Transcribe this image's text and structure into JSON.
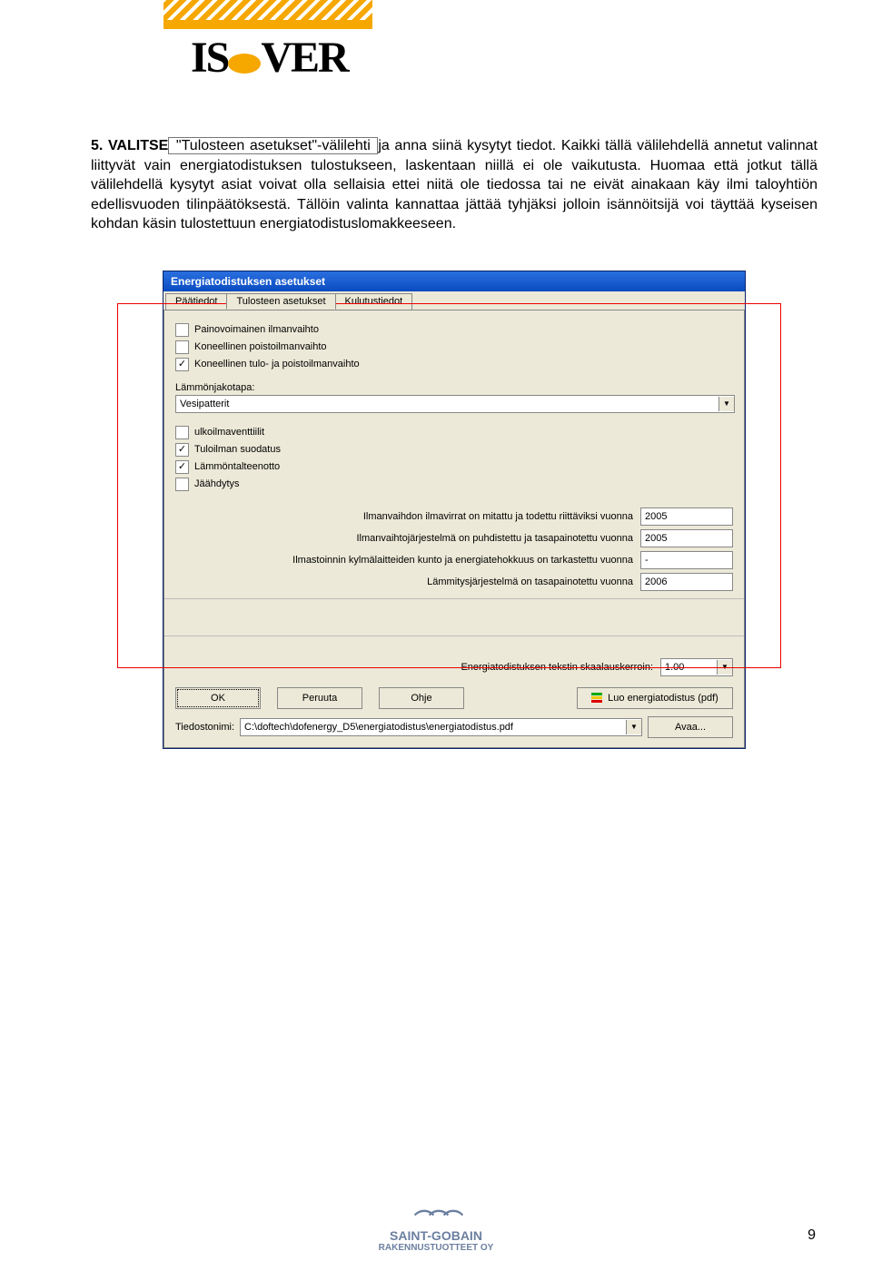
{
  "header": {
    "logo_text": "ISOVER"
  },
  "body": {
    "lead": "5. VALITSE",
    "text_after_lead": " \"Tulosteen asetukset\"-välilehti ",
    "text_rest": "ja anna siinä kysytyt tiedot. Kaikki tällä välilehdellä annetut valinnat liittyvät vain energiatodistuksen tulostukseen, laskentaan niillä ei ole vaikutusta. Huomaa että jotkut tällä välilehdellä kysytyt asiat voivat olla sellaisia ettei niitä ole tiedossa tai ne eivät ainakaan käy ilmi taloyhtiön edellisvuoden tilinpäätöksestä. Tällöin valinta kannattaa jättää tyhjäksi jolloin isännöitsijä voi täyttää kyseisen kohdan käsin tulostettuun energiatodistuslomakkeeseen."
  },
  "dialog": {
    "title": "Energiatodistuksen asetukset",
    "tabs": {
      "t0": "Päätiedot",
      "t1": "Tulosteen asetukset",
      "t2": "Kulutustiedot"
    },
    "checks": {
      "c1": "Painovoimainen ilmanvaihto",
      "c2": "Koneellinen poistoilmanvaihto",
      "c3": "Koneellinen tulo- ja poistoilmanvaihto",
      "c4": "ulkoilmaventtiilit",
      "c5": "Tuloilman suodatus",
      "c6": "Lämmöntalteenotto",
      "c7": "Jäähdytys"
    },
    "lammon_label": "Lämmönjakotapa:",
    "lammon_value": "Vesipatterit",
    "years": {
      "y1_label": "Ilmanvaihdon ilmavirrat on mitattu ja todettu riittäviksi vuonna",
      "y1_val": "2005",
      "y2_label": "Ilmanvaihtojärjestelmä on puhdistettu ja tasapainotettu vuonna",
      "y2_val": "2005",
      "y3_label": "Ilmastoinnin kylmälaitteiden kunto ja energiatehokkuus on tarkastettu vuonna",
      "y3_val": "-",
      "y4_label": "Lämmitysjärjestelmä on tasapainotettu vuonna",
      "y4_val": "2006"
    },
    "scale_label": "Energiatodistuksen tekstin skaalauskerroin:",
    "scale_value": "1.00",
    "buttons": {
      "ok": "OK",
      "cancel": "Peruuta",
      "help": "Ohje",
      "pdf": "Luo energiatodistus (pdf)",
      "open": "Avaa..."
    },
    "file_label": "Tiedostonimi:",
    "file_value": "C:\\doftech\\dofenergy_D5\\energiatodistus\\energiatodistus.pdf"
  },
  "footer": {
    "brand": "SAINT-GOBAIN",
    "sub": "RAKENNUSTUOTTEET OY",
    "page": "9"
  }
}
